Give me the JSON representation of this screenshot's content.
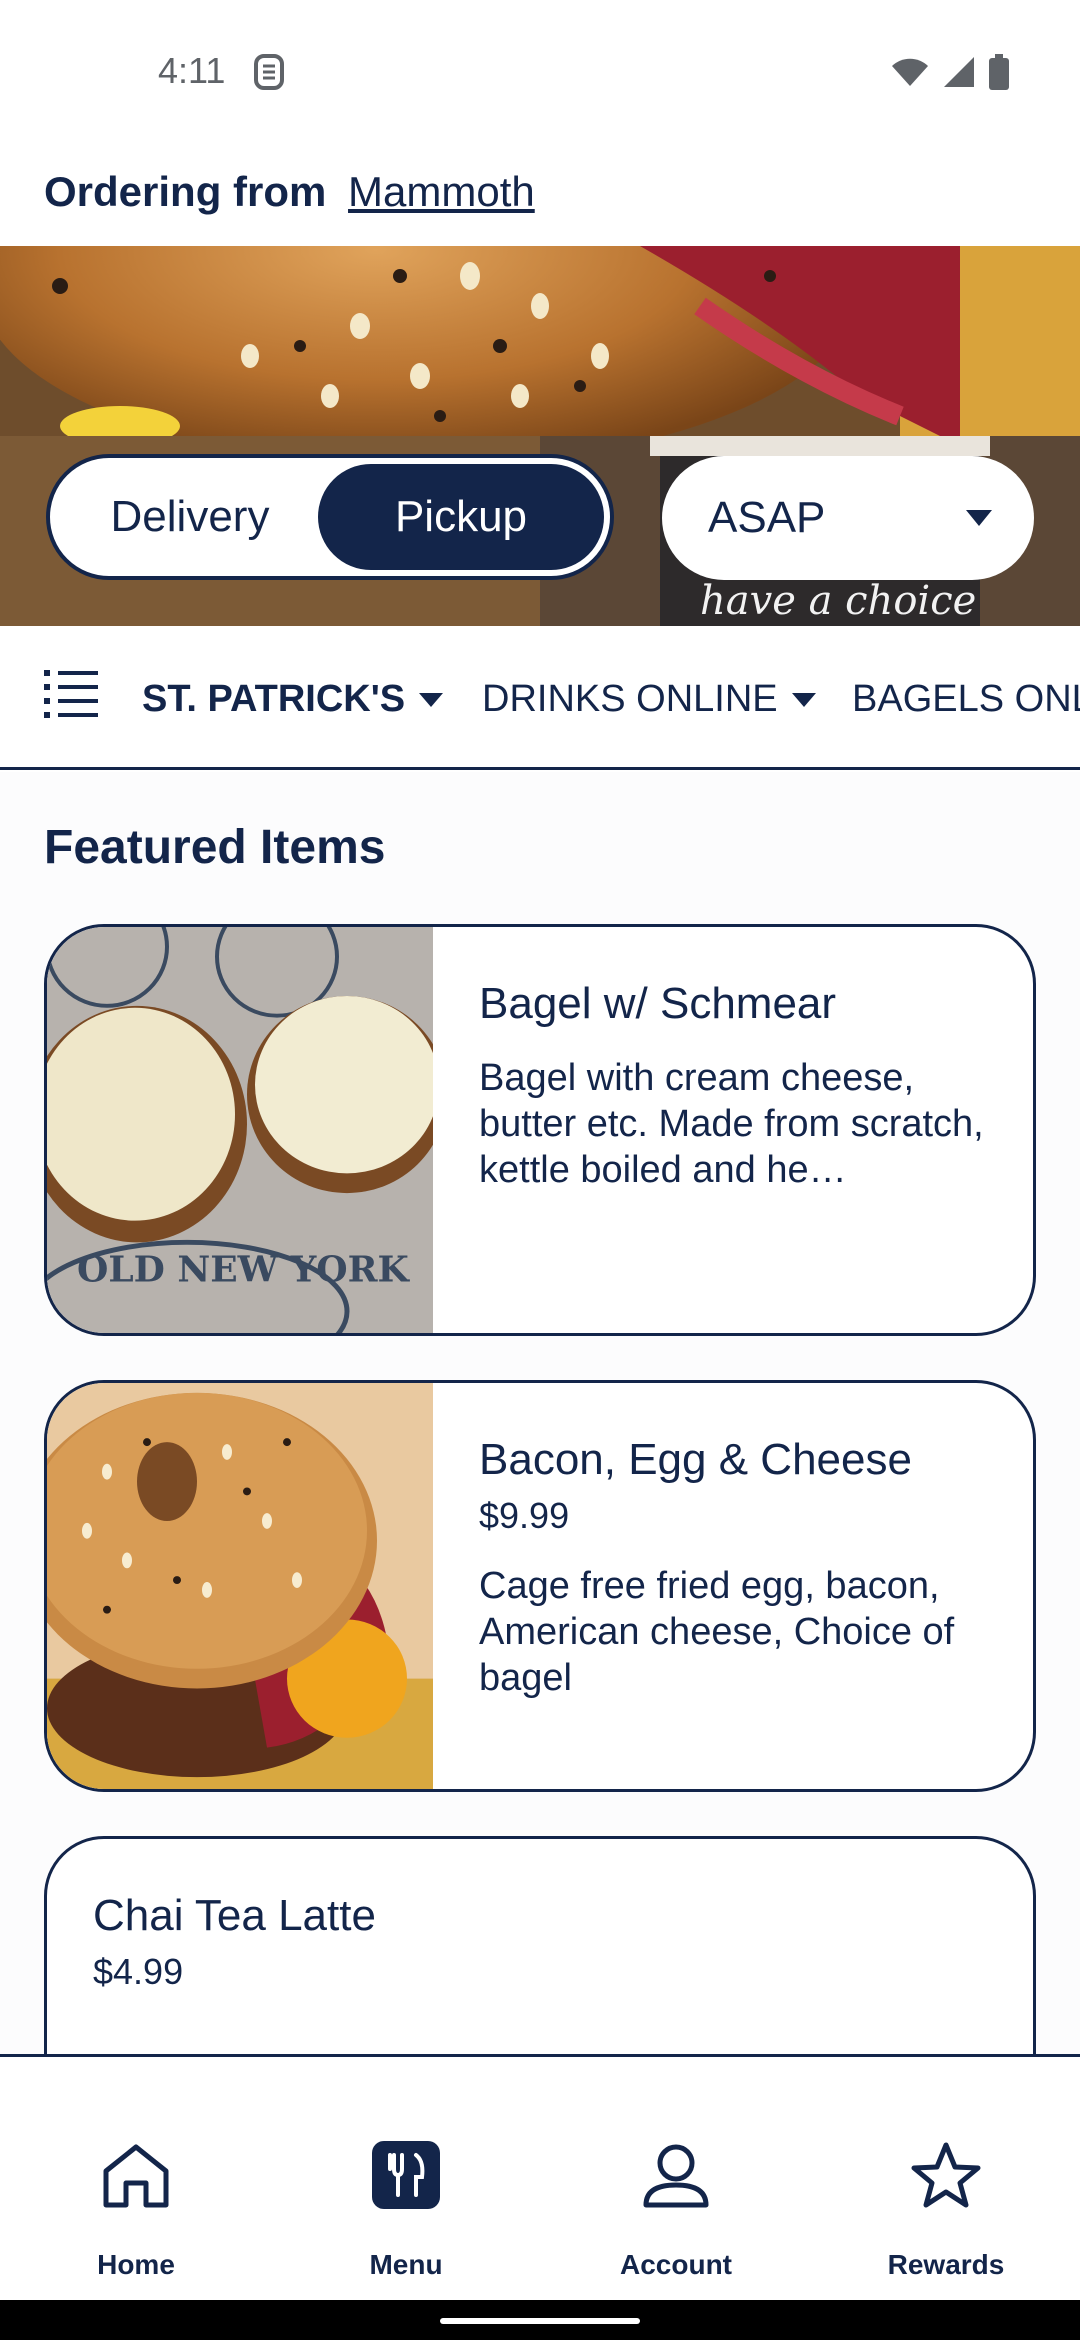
{
  "status_bar": {
    "time": "4:11",
    "icons": [
      "app-notification-icon",
      "wifi-icon",
      "signal-icon",
      "battery-icon"
    ]
  },
  "header": {
    "ordering_from_label": "Ordering from",
    "location": "Mammoth"
  },
  "order_options": {
    "modes": [
      "Delivery",
      "Pickup"
    ],
    "selected_mode": "Pickup",
    "time_value": "ASAP"
  },
  "categories": {
    "items": [
      "ST. PATRICK'S",
      "DRINKS ONLINE",
      "BAGELS ONL"
    ],
    "active": "ST. PATRICK'S"
  },
  "featured": {
    "title": "Featured Items",
    "items": [
      {
        "name": "Bagel w/ Schmear",
        "description": "Bagel with cream cheese, butter etc. Made from scratch, kettle boiled and he…"
      },
      {
        "name": "Bacon, Egg & Cheese",
        "price": "$9.99",
        "description": "Cage free fried egg, bacon, American cheese, Choice of bagel"
      },
      {
        "name": "Chai Tea Latte",
        "price": "$4.99"
      }
    ]
  },
  "bottom_nav": {
    "items": [
      {
        "label": "Home",
        "icon": "home-icon"
      },
      {
        "label": "Menu",
        "icon": "menu-utensils-icon"
      },
      {
        "label": "Account",
        "icon": "account-icon"
      },
      {
        "label": "Rewards",
        "icon": "star-icon"
      }
    ],
    "active": "Menu"
  },
  "colors": {
    "brand_navy": "#13254a",
    "background": "#ffffff"
  }
}
